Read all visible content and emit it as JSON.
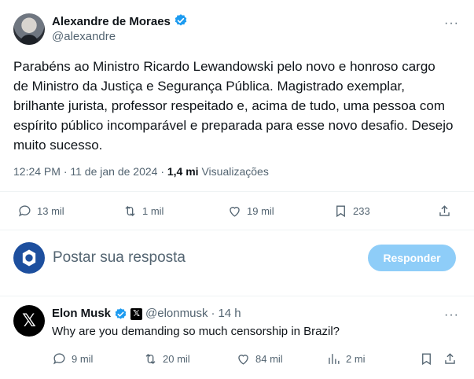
{
  "tweet": {
    "author_name": "Alexandre de Moraes",
    "author_handle": "@alexandre",
    "more": "···",
    "text": "Parabéns ao Ministro Ricardo Lewandowski pelo novo e honroso cargo de Ministro da Justiça e Segurança Pública. Magistrado exemplar, brilhante jurista, professor respeitado e, acima de tudo, uma pessoa com espírito público incomparável e preparada para esse novo desafio. Desejo muito sucesso.",
    "time": "12:24 PM · 11 de jan de 2024 · ",
    "views_count": "1,4 mi",
    "views_label": "Visualizações",
    "actions": {
      "replies": "13 mil",
      "reposts": "1 mil",
      "likes": "19 mil",
      "bookmarks": "233"
    }
  },
  "composer": {
    "placeholder": "Postar sua resposta",
    "button_label": "Responder"
  },
  "reply": {
    "author_name": "Elon Musk",
    "author_handle": "@elonmusk",
    "separator": "·",
    "age": "14 h",
    "more": "···",
    "text": "Why are you demanding so much censorship in Brazil?",
    "actions": {
      "replies": "9 mil",
      "reposts": "20 mil",
      "likes": "84 mil",
      "views": "2 mi"
    }
  },
  "colors": {
    "accent": "#1d9bf0",
    "button_disabled": "#8ecdf8",
    "secondary_text": "#536471"
  }
}
